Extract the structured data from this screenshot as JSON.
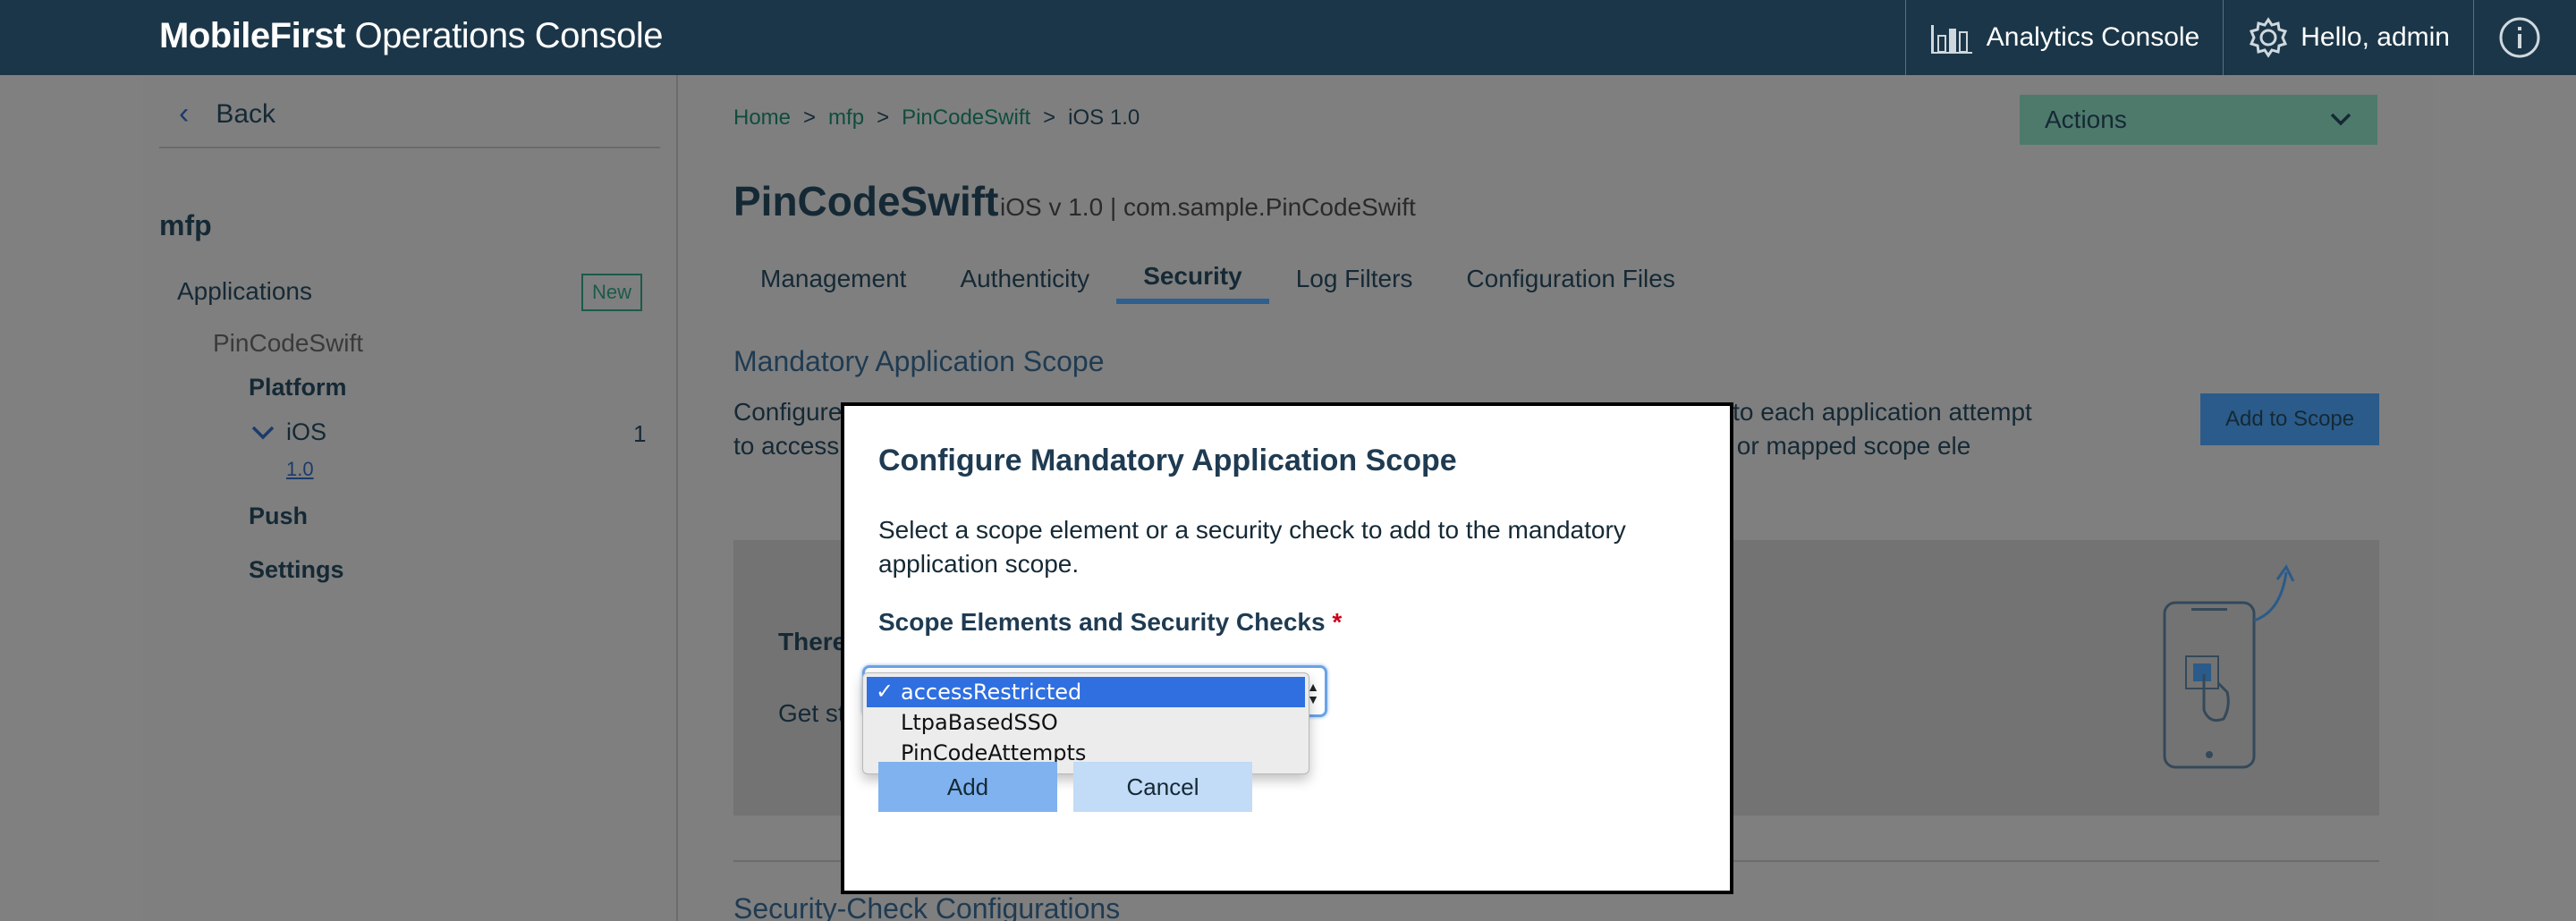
{
  "topbar": {
    "brand_bold": "MobileFirst",
    "brand_rest": " Operations Console",
    "analytics": "Analytics Console",
    "user": "Hello, admin"
  },
  "sidebar": {
    "back": "Back",
    "runtime": "mfp",
    "applications": "Applications",
    "new_badge": "New",
    "app": "PinCodeSwift",
    "platform": "Platform",
    "ios": "iOS",
    "ios_count": "1",
    "version": "1.0",
    "push": "Push",
    "settings": "Settings"
  },
  "breadcrumb": [
    "Home",
    "mfp",
    "PinCodeSwift",
    "iOS 1.0"
  ],
  "actions_label": "Actions",
  "app_title": "PinCodeSwift",
  "app_subtitle": "iOS v 1.0 | com.sample.PinCodeSwift",
  "tabs": [
    "Management",
    "Authenticity",
    "Security",
    "Log Filters",
    "Configuration Files"
  ],
  "active_tab": "Security",
  "section": {
    "heading": "Mandatory Application Scope",
    "description": "Configure                                                                                                                                to each application attempt to access                                                                                                              rity checks, or mapped scope ele",
    "add_to_scope": "Add to Scope",
    "panel_line1": "There",
    "panel_line2": "Get st"
  },
  "section2_heading": "Security-Check Configurations",
  "dialog": {
    "title": "Configure Mandatory Application Scope",
    "description": "Select a scope element or a security check to add to the mandatory application scope.",
    "field_label": "Scope Elements and Security Checks",
    "required_mark": "*",
    "options": [
      "accessRestricted",
      "LtpaBasedSSO",
      "PinCodeAttempts"
    ],
    "selected": "accessRestricted",
    "check_mark": "✓",
    "add": "Add",
    "cancel": "Cancel"
  }
}
